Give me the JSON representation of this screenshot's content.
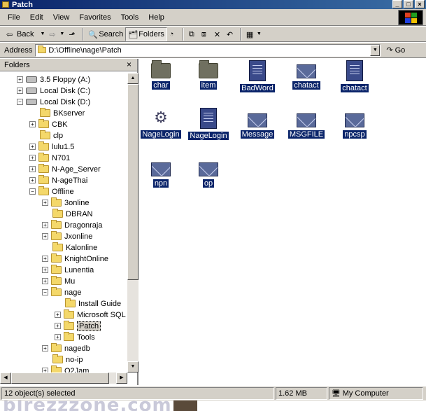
{
  "window": {
    "title": "Patch"
  },
  "menu": [
    "File",
    "Edit",
    "View",
    "Favorites",
    "Tools",
    "Help"
  ],
  "toolbar": {
    "back": "Back",
    "search": "Search",
    "folders": "Folders"
  },
  "address": {
    "label": "Address",
    "value": "D:\\Offline\\nage\\Patch",
    "go": "Go"
  },
  "folders_panel": {
    "title": "Folders",
    "close": "×",
    "tree": [
      "3.5 Floppy (A:)",
      "Local Disk (C:)",
      "Local Disk (D:)",
      "BKserver",
      "CBK",
      "clp",
      "lulu1.5",
      "N701",
      "N-Age_Server",
      "N-ageThai",
      "Offline",
      "3online",
      "DBRAN",
      "Dragonraja",
      "Jxonline",
      "Kalonline",
      "KnightOnline",
      "Lunentia",
      "Mu",
      "nage",
      "Install Guide",
      "Microsoft SQL S",
      "Patch",
      "Tools",
      "nagedb",
      "no-ip",
      "O2Jam"
    ]
  },
  "files": [
    {
      "name": "char",
      "icon": "folder-icon"
    },
    {
      "name": "item",
      "icon": "folder-icon"
    },
    {
      "name": "BadWord",
      "icon": "document-icon"
    },
    {
      "name": "chatact",
      "icon": "mail-icon"
    },
    {
      "name": "chatact",
      "icon": "document-icon"
    },
    {
      "name": "NageLogin",
      "icon": "exe-icon"
    },
    {
      "name": "NageLogin",
      "icon": "config-icon"
    },
    {
      "name": "Message",
      "icon": "mail-icon"
    },
    {
      "name": "MSGFILE",
      "icon": "mail-icon"
    },
    {
      "name": "npcsp",
      "icon": "mail-icon"
    },
    {
      "name": "npn",
      "icon": "mail-icon"
    },
    {
      "name": "op",
      "icon": "mail-icon"
    }
  ],
  "status": {
    "selected": "12 object(s) selected",
    "size": "1.62 MB",
    "location": "My Computer"
  },
  "watermark": "blrezzzone.com",
  "colors": {
    "title_start": "#0a246a",
    "title_end": "#3a6ea5",
    "chrome": "#d4d0c8",
    "selection": "#0a246a"
  }
}
